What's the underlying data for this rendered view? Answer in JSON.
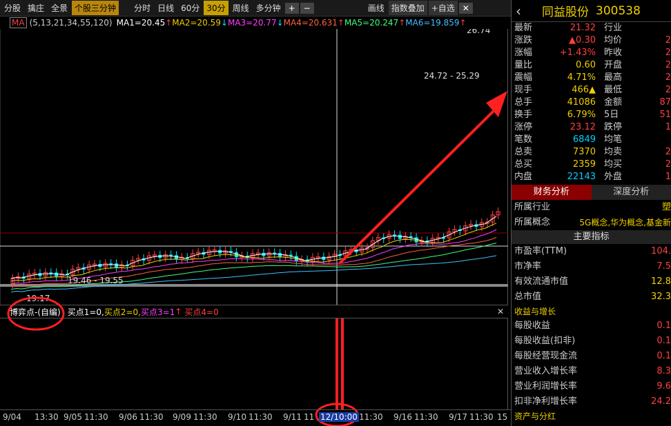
{
  "toolbar": {
    "items": [
      "分股",
      "擒庄",
      "全景",
      "个股三分钟",
      "分时",
      "日线",
      "60分",
      "30分",
      "周线",
      "多分钟",
      "画线",
      "指数叠加",
      "+自选"
    ],
    "active_index": 3,
    "period_active_index": 7
  },
  "ma_bar": {
    "selector": "MA",
    "params": "(5,13,21,34,55,120)",
    "ma1": "MA1=20.45",
    "ma2": "MA2=20.59",
    "ma3": "MA3=20.77",
    "ma4": "MA4=20.631",
    "ma5": "MA5=20.247",
    "ma6": "MA6=19.859"
  },
  "chart": {
    "high_label": "26.74",
    "range_label": "24.72 - 25.29",
    "low_label": "19.17",
    "mid_label": "19.46 - 19.55"
  },
  "lower_indicator": {
    "name": "博弈点-(自编)",
    "b1": "买点1=0,",
    "b2": "买点2=0,",
    "b3": "买点3=1",
    "b4": "买点4=0"
  },
  "time_axis": [
    "9/04",
    "13:30",
    "9/05",
    "11:30",
    "9/06",
    "11:30",
    "9/09",
    "11:30",
    "9/10",
    "11:30",
    "9/11",
    "11",
    "12/10:00",
    "11:30",
    "9/16",
    "11:30",
    "9/17",
    "11:30",
    "15"
  ],
  "stock": {
    "name": "同益股份",
    "code": "300538"
  },
  "quotes": [
    {
      "l1": "最新",
      "v1": "21.32",
      "c1": "#ff4040",
      "l2": "行业",
      "v2": ""
    },
    {
      "l1": "涨跌",
      "v1": "▲0.30",
      "c1": "#ff4040",
      "l2": "均价",
      "v2": "2"
    },
    {
      "l1": "涨幅",
      "v1": "+1.43%",
      "c1": "#ff4040",
      "l2": "昨收",
      "v2": "2"
    },
    {
      "l1": "量比",
      "v1": "0.60",
      "c1": "#f0d000",
      "l2": "开盘",
      "v2": "2"
    },
    {
      "l1": "震幅",
      "v1": "4.71%",
      "c1": "#f0d000",
      "l2": "最高",
      "v2": "2"
    },
    {
      "l1": "现手",
      "v1": "466▲",
      "c1": "#f0d000",
      "l2": "最低",
      "v2": "2"
    },
    {
      "l1": "总手",
      "v1": "41086",
      "c1": "#f0d000",
      "l2": "金额",
      "v2": "87"
    },
    {
      "l1": "换手",
      "v1": "6.79%",
      "c1": "#f0d000",
      "l2": "5日",
      "v2": "51"
    },
    {
      "l1": "涨停",
      "v1": "23.12",
      "c1": "#ff4040",
      "l2": "跌停",
      "v2": "1"
    },
    {
      "l1": "笔数",
      "v1": "6849",
      "c1": "#00d0ff",
      "l2": "均笔",
      "v2": ""
    },
    {
      "l1": "总卖",
      "v1": "7370",
      "c1": "#f0d000",
      "l2": "均卖",
      "v2": "2"
    },
    {
      "l1": "总买",
      "v1": "2359",
      "c1": "#f0d000",
      "l2": "均买",
      "v2": "2"
    },
    {
      "l1": "内盘",
      "v1": "22143",
      "c1": "#00d0ff",
      "l2": "外盘",
      "v2": "1"
    }
  ],
  "fin_tabs": [
    "财务分析",
    "深度分析"
  ],
  "fin": {
    "industry_label": "所属行业",
    "industry_value": "塑",
    "concept_label": "所属概念",
    "concept_value": "5G概念,华为概念,基金新",
    "main_title": "主要指标",
    "pe_label": "市盈率(TTM)",
    "pe_value": "104.",
    "pb_label": "市净率",
    "pb_value": "7.5",
    "float_label": "有效流通市值",
    "float_value": "12.8",
    "total_label": "总市值",
    "total_value": "32.3",
    "growth_title": "收益与增长",
    "eps_label": "每股收益",
    "eps_value": "0.1",
    "eps2_label": "每股收益(扣非)",
    "eps2_value": "0.1",
    "cf_label": "每股经营现金流",
    "cf_value": "0.1",
    "rev_label": "营业收入增长率",
    "rev_value": "8.3",
    "profit_label": "营业利润增长率",
    "profit_value": "9.6",
    "np_label": "扣非净利增长率",
    "np_value": "24.2",
    "assets_title": "资产与分红"
  },
  "colors": {
    "up": "#ff4040",
    "down": "#00e5ff",
    "ma1": "#ffffff",
    "ma2": "#f0d000",
    "ma3": "#ff40ff",
    "ma4": "#ff6040",
    "ma5": "#40ff80",
    "ma6": "#40c0ff"
  }
}
